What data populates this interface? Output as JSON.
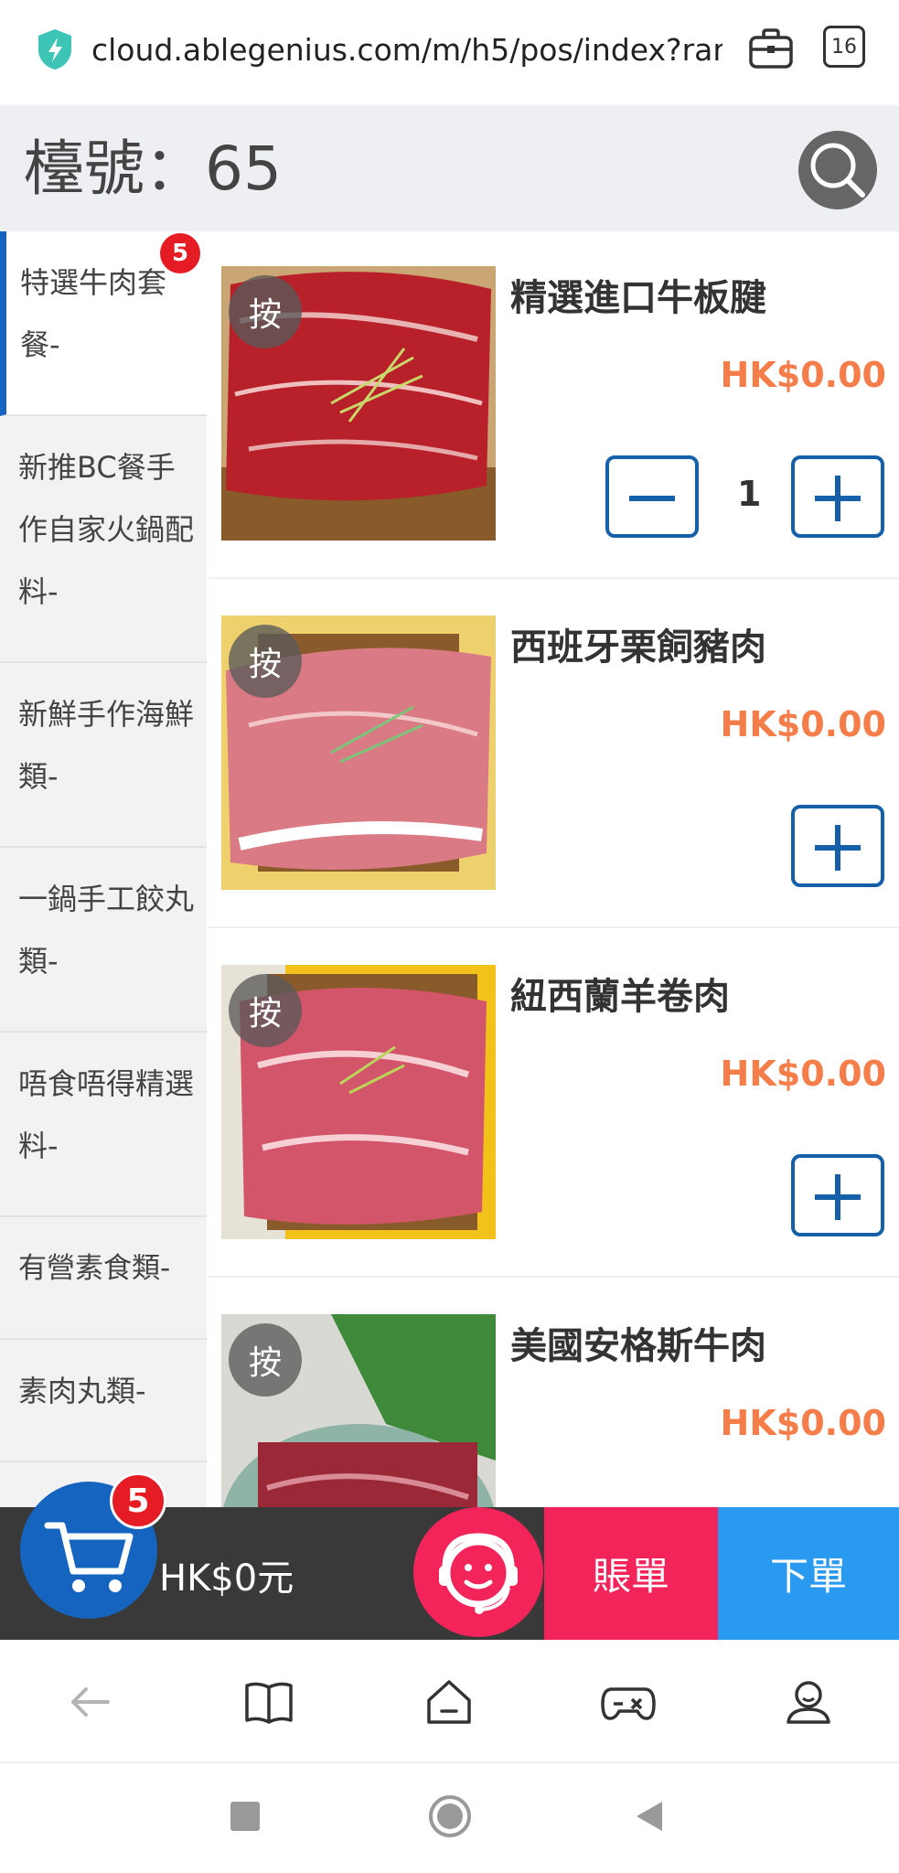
{
  "browser": {
    "url": "cloud.ablegenius.com/m/h5/pos/index?ran",
    "tabs_count": "16"
  },
  "header": {
    "table_label": "檯號：65"
  },
  "sidebar": {
    "items": [
      {
        "label": "特選牛肉套餐-",
        "badge": "5",
        "active": true
      },
      {
        "label": "新推BC餐手作自家火鍋配料-"
      },
      {
        "label": "新鮮手作海鮮類-"
      },
      {
        "label": "一鍋手工餃丸類-"
      },
      {
        "label": "唔食唔得精選料-"
      },
      {
        "label": "有營素食類-"
      },
      {
        "label": "素肉丸類-"
      }
    ]
  },
  "products": [
    {
      "name": "精選進口牛板腱",
      "price": "HK$0.00",
      "press_label": "按",
      "quantity": "1"
    },
    {
      "name": "西班牙栗飼豬肉",
      "price": "HK$0.00",
      "press_label": "按"
    },
    {
      "name": "紐西蘭羊卷肉",
      "price": "HK$0.00",
      "press_label": "按"
    },
    {
      "name": "美國安格斯牛肉",
      "price": "HK$0.00",
      "press_label": "按"
    }
  ],
  "cart": {
    "badge": "5",
    "total": "HK$0元",
    "bill_label": "賬單",
    "order_label": "下單"
  },
  "colors": {
    "accent_blue": "#1565c0",
    "price_orange": "#f47d4a",
    "bill_red": "#f2245a",
    "order_blue": "#2a99f0",
    "badge_red": "#e51c23"
  }
}
